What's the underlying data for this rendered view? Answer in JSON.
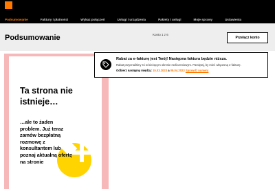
{
  "nav": {
    "items": [
      {
        "label": "Podsumowanie"
      },
      {
        "label": "Faktury i płatności"
      },
      {
        "label": "Wykaz połączeń"
      },
      {
        "label": "Usługi i urządzenia"
      },
      {
        "label": "Pakiety i usługi"
      },
      {
        "label": "Moje sprawy"
      },
      {
        "label": "Ustawienia"
      }
    ]
  },
  "header": {
    "title": "Podsumowanie",
    "account_counter": "Konto 1 z 6",
    "switch_button": "Przełącz konto"
  },
  "promo": {
    "title": "Ta strona nie istnieje…",
    "text": "…ale to żaden problem. Już teraz zamów bezpłatną rozmowę z konsultantem lub poznaj aktualną ofertę na stronie"
  },
  "notice": {
    "title": "Rabat za e-fakturę jest Twój! Następna faktura będzie niższa.",
    "body": "Rabat przyznaliśmy Ci w bieżącym okresie rozliczeniowym. Pamiętaj, by mieć włączoną e-fakturę.",
    "dates_prefix": "Odbierz następny między:",
    "date_from": "15.03.2023",
    "dates_and": "a",
    "date_to": "09.04.2023",
    "link": "Sprawdź numery"
  },
  "colors": {
    "brand": "#ff7900",
    "promo_border": "#f6b8b8",
    "promo_accent": "#ffd400"
  }
}
